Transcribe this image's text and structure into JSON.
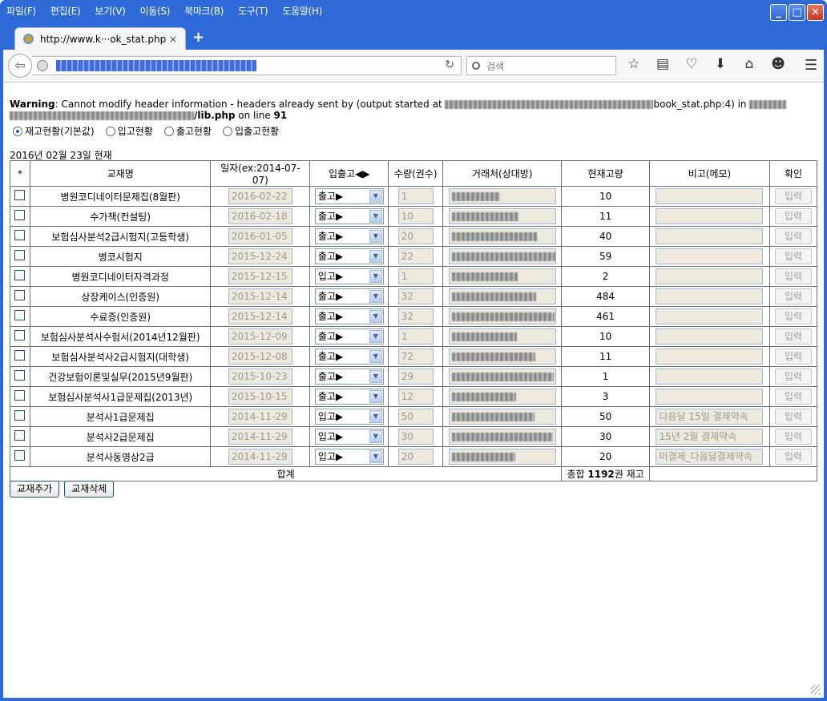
{
  "menubar": [
    "파일(F)",
    "편집(E)",
    "보기(V)",
    "이동(S)",
    "북마크(B)",
    "도구(T)",
    "도움말(H)"
  ],
  "tab": {
    "title": "http://www.k···ok_stat.php",
    "close": "×"
  },
  "newtab": "+",
  "search": {
    "placeholder": "검색"
  },
  "warning": {
    "label": "Warning",
    "text1": ": Cannot modify header information - headers already sent by (output started at ",
    "text2": "book_stat.php:4) in ",
    "file": "/lib.php",
    "text3": " on line ",
    "line": "91"
  },
  "radios": [
    {
      "label": "재고현황(기본값)",
      "checked": true
    },
    {
      "label": "입고현황",
      "checked": false
    },
    {
      "label": "출고현황",
      "checked": false
    },
    {
      "label": "입출고현황",
      "checked": false
    }
  ],
  "date_label": "2016년 02월 23일 현재",
  "headers": [
    "*",
    "교재명",
    "일자(ex:2014-07-07)",
    "입출고◀▶",
    "수량(권수)",
    "거래처(상대방)",
    "현재고량",
    "비고(메모)",
    "확인"
  ],
  "rows": [
    {
      "name": "병원코디네이터문제집(8월판)",
      "date": "2016-02-22",
      "io": "출고▶",
      "qty": "1",
      "stock": "10",
      "memo": ""
    },
    {
      "name": "수가책(컨설팅)",
      "date": "2016-02-18",
      "io": "출고▶",
      "qty": "10",
      "stock": "11",
      "memo": ""
    },
    {
      "name": "보험심사분석2급시험지(고등학생)",
      "date": "2016-01-05",
      "io": "출고▶",
      "qty": "20",
      "stock": "40",
      "memo": ""
    },
    {
      "name": "병코시험지",
      "date": "2015-12-24",
      "io": "출고▶",
      "qty": "22",
      "stock": "59",
      "memo": ""
    },
    {
      "name": "병원코디네이터자격과정",
      "date": "2015-12-15",
      "io": "입고▶",
      "qty": "1",
      "stock": "2",
      "memo": ""
    },
    {
      "name": "상장케이스(인증원)",
      "date": "2015-12-14",
      "io": "출고▶",
      "qty": "32",
      "stock": "484",
      "memo": ""
    },
    {
      "name": "수료증(인증원)",
      "date": "2015-12-14",
      "io": "출고▶",
      "qty": "32",
      "stock": "461",
      "memo": ""
    },
    {
      "name": "보험심사분석사수험서(2014년12월판)",
      "date": "2015-12-09",
      "io": "출고▶",
      "qty": "1",
      "stock": "10",
      "memo": ""
    },
    {
      "name": "보험심사분석사2급시험지(대학생)",
      "date": "2015-12-08",
      "io": "출고▶",
      "qty": "72",
      "stock": "11",
      "memo": ""
    },
    {
      "name": "건강보험이론및실무(2015년9월판)",
      "date": "2015-10-23",
      "io": "출고▶",
      "qty": "29",
      "stock": "1",
      "memo": ""
    },
    {
      "name": "보험심사분석사1급문제집(2013년)",
      "date": "2015-10-15",
      "io": "출고▶",
      "qty": "12",
      "stock": "3",
      "memo": ""
    },
    {
      "name": "분석사1급문제집",
      "date": "2014-11-29",
      "io": "입고▶",
      "qty": "50",
      "stock": "50",
      "memo": "다음달 15일 결제약속"
    },
    {
      "name": "분석사2급문제집",
      "date": "2014-11-29",
      "io": "입고▶",
      "qty": "30",
      "stock": "30",
      "memo": "15년 2월 결제약속"
    },
    {
      "name": "분석사동영상2급",
      "date": "2014-11-29",
      "io": "입고▶",
      "qty": "20",
      "stock": "20",
      "memo": "미결제_다음달결제약속"
    }
  ],
  "confirm_label": "입력",
  "footer": {
    "total_label": "합계",
    "total_prefix": "총합 ",
    "total_value": "1192",
    "total_suffix": "권 재고"
  },
  "buttons": {
    "add": "교재추가",
    "delete": "교재삭제"
  }
}
